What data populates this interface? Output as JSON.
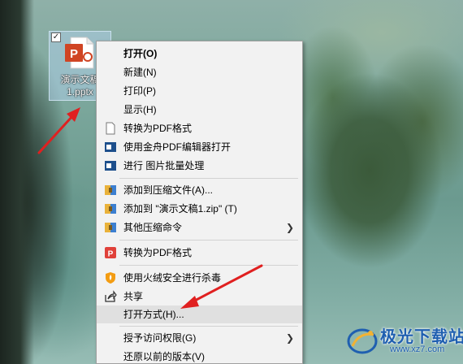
{
  "desktop": {
    "file": {
      "name_line1": "演示文稿",
      "name_line2": "1.pptx",
      "checked_glyph": "✓",
      "icon": "powerpoint-file-icon"
    }
  },
  "context_menu": {
    "items": [
      {
        "label": "打开(O)",
        "bold": true
      },
      {
        "label": "新建(N)"
      },
      {
        "label": "打印(P)"
      },
      {
        "label": "显示(H)"
      },
      {
        "label": "转换为PDF格式",
        "icon": "document-icon"
      },
      {
        "label": "使用金舟PDF编辑器打开",
        "icon": "pdf-editor-icon"
      },
      {
        "label": "进行 图片批量处理",
        "icon": "image-batch-icon"
      },
      {
        "label": "添加到压缩文件(A)...",
        "icon": "archive-icon"
      },
      {
        "label": "添加到 \"演示文稿1.zip\" (T)",
        "icon": "archive-icon"
      },
      {
        "label": "其他压缩命令",
        "icon": "archive-icon",
        "submenu_glyph": "❯"
      },
      {
        "label": "转换为PDF格式",
        "icon": "pdf-convert-icon"
      },
      {
        "label": "使用火绒安全进行杀毒",
        "icon": "huorong-shield-icon"
      },
      {
        "label": "共享",
        "icon": "share-icon"
      },
      {
        "label": "打开方式(H)...",
        "highlighted": true
      },
      {
        "label": "授予访问权限(G)",
        "submenu_glyph": "❯"
      },
      {
        "label": "还原以前的版本(V)"
      }
    ]
  },
  "annotations": {
    "arrow_color": "#e02020"
  },
  "watermark": {
    "title": "极光下载站",
    "url": "www.xz7.com"
  }
}
